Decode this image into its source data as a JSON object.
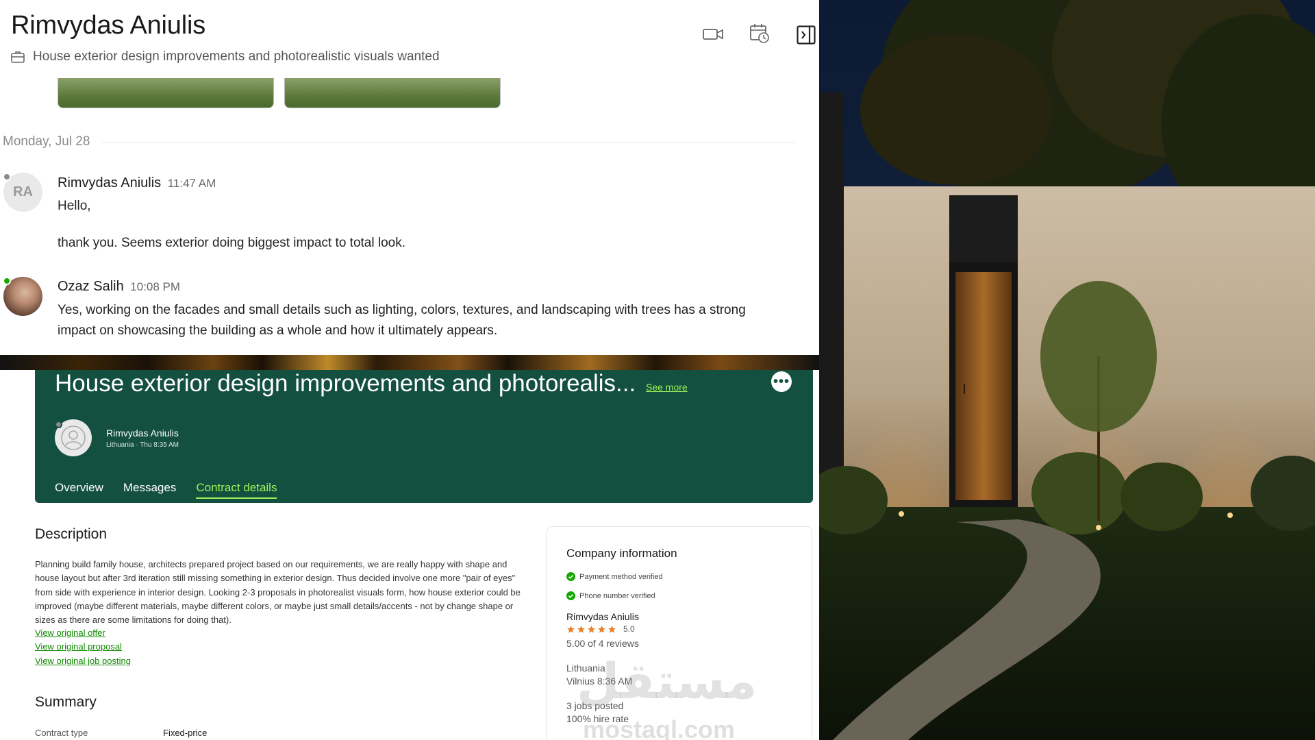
{
  "chat": {
    "title": "Rimvydas Aniulis",
    "subtitle": "House exterior design improvements and photorealistic visuals wanted",
    "date_separator": "Monday, Jul 28",
    "messages": [
      {
        "initials": "RA",
        "sender": "Rimvydas Aniulis",
        "time": "11:47 AM",
        "lines": [
          "Hello,",
          "thank you. Seems exterior doing biggest impact to total look."
        ]
      },
      {
        "sender": "Ozaz Salih",
        "time": "10:08 PM",
        "text": "Yes, working on the facades and small details such as lighting, colors, textures, and landscaping with trees has a strong impact on showcasing the building as a whole and how it ultimately appears."
      }
    ],
    "icons": [
      "briefcase-icon",
      "video-call-icon",
      "schedule-icon",
      "sidebar-toggle-icon"
    ]
  },
  "contract": {
    "title": "House exterior design improvements and photorealis...",
    "see_more": "See more",
    "client_name": "Rimvydas Aniulis",
    "client_location": "Lithuania · Thu 8:35 AM",
    "tabs": [
      {
        "label": "Overview"
      },
      {
        "label": "Messages"
      },
      {
        "label": "Contract details"
      }
    ],
    "active_tab": "Contract details",
    "description_title": "Description",
    "description": "Planning build family house, architects prepared project based on our requirements, we are really happy with shape and house layout but after 3rd iteration still missing something in exterior design. Thus decided involve one more \"pair of eyes\" from side with experience in interior design. Looking 2-3 proposals in photorealist visuals form, how house exterior could be improved (maybe different materials, maybe different colors, or maybe just small details/accents - not by change shape or sizes as there are some limitations for doing that).",
    "links": [
      "View original offer",
      "View original proposal",
      "View original job posting"
    ],
    "summary_title": "Summary",
    "summary": {
      "label": "Contract type",
      "value": "Fixed-price"
    }
  },
  "company": {
    "title": "Company information",
    "payment": "Payment method verified",
    "phone": "Phone number verified",
    "name": "Rimvydas Aniulis",
    "rating": "5.0",
    "rating_value": 5.0,
    "reviews": "5.00 of 4 reviews",
    "country": "Lithuania",
    "city_time": "Vilnius 8:36 AM",
    "jobs": "3 jobs posted",
    "hire_rate": "100% hire rate"
  },
  "watermark": {
    "arabic": "مستقل",
    "latin": "mostaql.com"
  },
  "colors": {
    "brand_green": "#14503f",
    "accent_green": "#9cf25a",
    "link_green": "#108a00",
    "star_orange": "#e8822a",
    "online_green": "#14a800"
  }
}
